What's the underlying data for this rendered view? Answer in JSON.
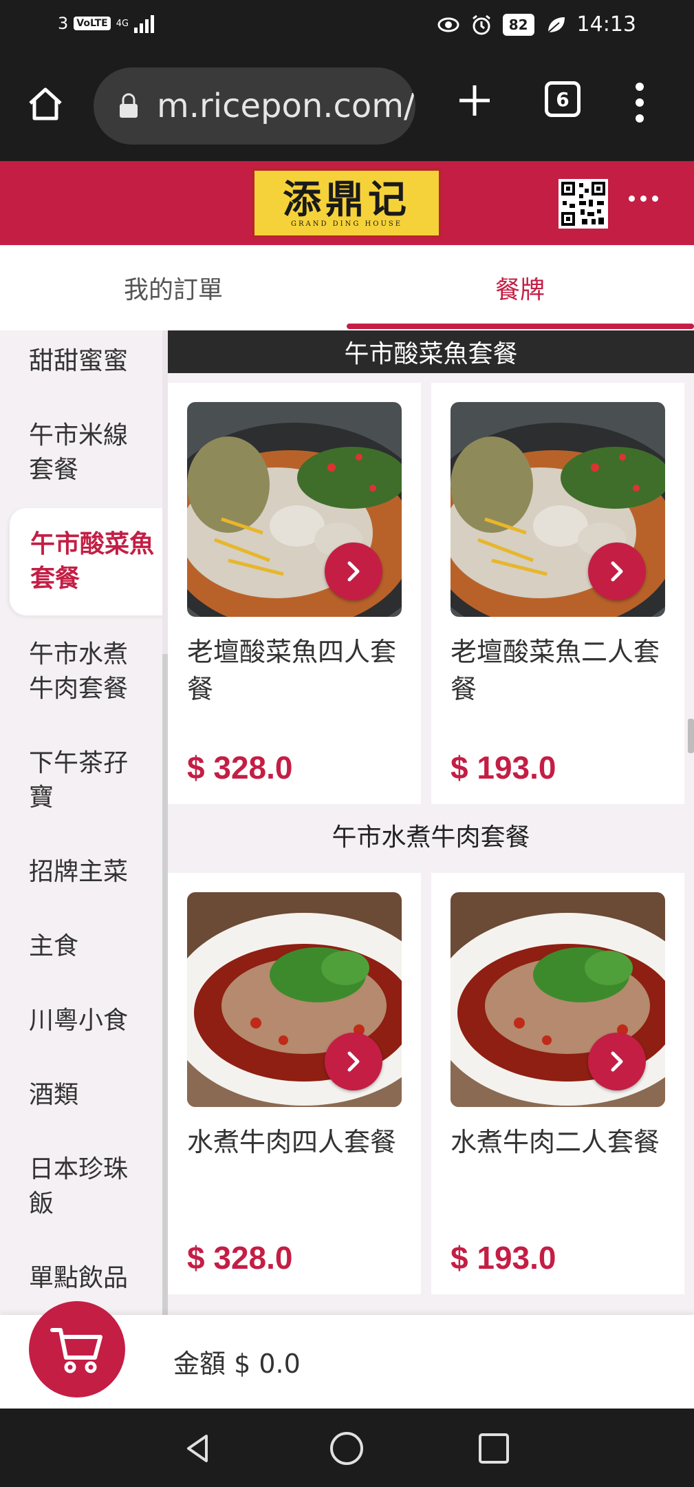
{
  "status_bar": {
    "sim": "3",
    "volte": "VoLTE",
    "network": "4G",
    "battery": "82",
    "time": "14:13"
  },
  "browser": {
    "url": "m.ricepon.com/",
    "tab_count": "6"
  },
  "header": {
    "logo_text": "添鼎记",
    "logo_subtext": "GRAND  DING  HOUSE"
  },
  "tabs": {
    "orders": "我的訂單",
    "menu": "餐牌"
  },
  "sidebar": {
    "items": [
      {
        "label": "甜甜蜜蜜",
        "active": false
      },
      {
        "label": "午市米線套餐",
        "active": false
      },
      {
        "label": "午市酸菜魚套餐",
        "active": true
      },
      {
        "label": "午市水煮牛肉套餐",
        "active": false
      },
      {
        "label": "下午茶孖寶",
        "active": false
      },
      {
        "label": "招牌主菜",
        "active": false
      },
      {
        "label": "主食",
        "active": false
      },
      {
        "label": "川粵小食",
        "active": false
      },
      {
        "label": "酒類",
        "active": false
      },
      {
        "label": "日本珍珠飯",
        "active": false
      },
      {
        "label": "單點飲品",
        "active": false
      }
    ]
  },
  "sections": [
    {
      "title": "午市酸菜魚套餐",
      "items": [
        {
          "name": "老壇酸菜魚四人套餐",
          "price": "$ 328.0",
          "image": "suancai-fish-photo"
        },
        {
          "name": "老壇酸菜魚二人套餐",
          "price": "$ 193.0",
          "image": "suancai-fish-photo"
        }
      ]
    },
    {
      "title": "午市水煮牛肉套餐",
      "items": [
        {
          "name": "水煮牛肉四人套餐",
          "price": "$ 328.0",
          "image": "boiled-beef-photo"
        },
        {
          "name": "水煮牛肉二人套餐",
          "price": "$ 193.0",
          "image": "boiled-beef-photo"
        }
      ]
    }
  ],
  "cart": {
    "total_label": "金額 $ 0.0"
  },
  "colors": {
    "brand": "#c41e45",
    "dark": "#1c1c1c",
    "background": "#f5f0f3"
  }
}
